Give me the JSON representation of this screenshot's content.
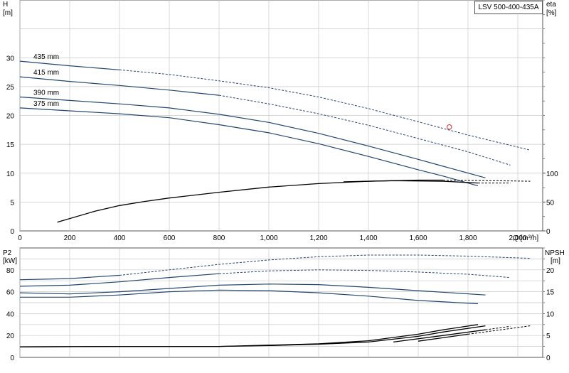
{
  "chart_data": [
    {
      "type": "line",
      "title": "LSV 500-400-435A",
      "x_unit_label": "Q [m³/h]",
      "xlim": [
        0,
        2100
      ],
      "x_ticks": [
        "0",
        "200",
        "400",
        "600",
        "800",
        "1,000",
        "1,200",
        "1,400",
        "1,600",
        "1,800",
        "2,000"
      ],
      "y_left": {
        "label": "H",
        "unit": "[m]",
        "ylim": [
          0,
          40
        ],
        "ticks": [
          "0",
          "5",
          "10",
          "15",
          "20",
          "25",
          "30"
        ]
      },
      "y_right": {
        "label": "eta",
        "unit": "[%]",
        "ylim": [
          0,
          400
        ],
        "ticks": [
          "0",
          "50",
          "100"
        ]
      },
      "grid": true,
      "head_curves": [
        {
          "name": "435 mm",
          "solid": [
            [
              0,
              29.4
            ],
            [
              200,
              28.6
            ],
            [
              400,
              27.9
            ]
          ],
          "dashed": [
            [
              400,
              27.9
            ],
            [
              600,
              27.1
            ],
            [
              800,
              26.0
            ],
            [
              1000,
              24.8
            ],
            [
              1200,
              23.2
            ],
            [
              1400,
              21.2
            ],
            [
              1600,
              18.9
            ],
            [
              1800,
              16.6
            ],
            [
              2050,
              14.0
            ]
          ]
        },
        {
          "name": "415 mm",
          "solid": [
            [
              0,
              26.7
            ],
            [
              200,
              25.9
            ],
            [
              400,
              25.2
            ],
            [
              600,
              24.4
            ],
            [
              800,
              23.5
            ]
          ],
          "dashed": [
            [
              800,
              23.5
            ],
            [
              1000,
              22.0
            ],
            [
              1200,
              20.3
            ],
            [
              1400,
              18.3
            ],
            [
              1600,
              16.0
            ],
            [
              1800,
              13.7
            ],
            [
              1970,
              11.4
            ]
          ]
        },
        {
          "name": "390 mm",
          "solid": [
            [
              0,
              23.2
            ],
            [
              200,
              22.6
            ],
            [
              400,
              22.0
            ],
            [
              600,
              21.3
            ],
            [
              800,
              20.2
            ],
            [
              1000,
              18.8
            ],
            [
              1200,
              16.9
            ],
            [
              1400,
              14.7
            ],
            [
              1600,
              12.4
            ],
            [
              1700,
              11.2
            ],
            [
              1870,
              9.2
            ]
          ],
          "dashed": []
        },
        {
          "name": "375 mm",
          "solid": [
            [
              0,
              21.3
            ],
            [
              200,
              20.8
            ],
            [
              400,
              20.3
            ],
            [
              600,
              19.6
            ],
            [
              800,
              18.4
            ],
            [
              1000,
              17.0
            ],
            [
              1200,
              15.1
            ],
            [
              1400,
              12.9
            ],
            [
              1600,
              10.6
            ],
            [
              1700,
              9.5
            ],
            [
              1840,
              7.8
            ]
          ],
          "dashed": []
        }
      ],
      "eta_curves": [
        {
          "solid": [
            [
              150,
              15
            ],
            [
              300,
              34
            ],
            [
              400,
              44
            ],
            [
              500,
              51
            ],
            [
              600,
              57
            ],
            [
              800,
              67
            ],
            [
              1000,
              76
            ],
            [
              1200,
              82
            ],
            [
              1400,
              86
            ],
            [
              1600,
              88
            ],
            [
              1700,
              88
            ]
          ],
          "dashed": [
            [
              1700,
              88
            ],
            [
              1900,
              87
            ],
            [
              2050,
              86
            ]
          ]
        },
        {
          "solid": [
            [
              1300,
              85
            ],
            [
              1500,
              87
            ],
            [
              1700,
              86
            ],
            [
              1840,
              83
            ]
          ],
          "dashed": [
            [
              1840,
              83
            ],
            [
              1970,
              83
            ]
          ]
        }
      ],
      "duty_point": {
        "x": 1725,
        "y": 18.0,
        "color": "#e0282d"
      }
    },
    {
      "type": "line",
      "xlim": [
        0,
        2100
      ],
      "y_left": {
        "label": "P2",
        "unit": "[kW]",
        "ylim": [
          0,
          100
        ],
        "ticks": [
          "0",
          "20",
          "40",
          "60",
          "80"
        ]
      },
      "y_right": {
        "label": "NPSH",
        "unit": "[m]",
        "ylim": [
          0,
          25
        ],
        "ticks": [
          "0",
          "5",
          "10",
          "15",
          "20"
        ]
      },
      "grid": true,
      "power_curves": [
        {
          "name": "435 mm",
          "solid": [
            [
              0,
              71
            ],
            [
              200,
              72
            ],
            [
              400,
              75
            ]
          ],
          "dashed": [
            [
              400,
              75
            ],
            [
              600,
              80
            ],
            [
              800,
              85
            ],
            [
              1000,
              89
            ],
            [
              1200,
              92
            ],
            [
              1400,
              93.5
            ],
            [
              1600,
              93.5
            ],
            [
              1800,
              92.5
            ],
            [
              2050,
              90.5
            ]
          ]
        },
        {
          "name": "415 mm",
          "solid": [
            [
              0,
              65
            ],
            [
              200,
              66
            ],
            [
              400,
              69
            ],
            [
              600,
              73
            ],
            [
              800,
              76.5
            ]
          ],
          "dashed": [
            [
              800,
              76.5
            ],
            [
              1000,
              79
            ],
            [
              1200,
              80
            ],
            [
              1400,
              79.5
            ],
            [
              1600,
              78
            ],
            [
              1800,
              76
            ],
            [
              1970,
              73
            ]
          ]
        },
        {
          "name": "390 mm",
          "solid": [
            [
              0,
              59
            ],
            [
              200,
              58
            ],
            [
              400,
              60
            ],
            [
              600,
              63
            ],
            [
              800,
              66
            ],
            [
              1000,
              67
            ],
            [
              1200,
              66.5
            ],
            [
              1400,
              64
            ],
            [
              1600,
              61
            ],
            [
              1870,
              57
            ]
          ],
          "dashed": []
        },
        {
          "name": "375 mm",
          "solid": [
            [
              0,
              55
            ],
            [
              200,
              55
            ],
            [
              400,
              57
            ],
            [
              600,
              60
            ],
            [
              800,
              61.5
            ],
            [
              1000,
              61
            ],
            [
              1200,
              59
            ],
            [
              1400,
              56
            ],
            [
              1600,
              52
            ],
            [
              1840,
              49
            ]
          ],
          "dashed": []
        }
      ],
      "npsh_curves": [
        {
          "solid": [
            [
              0,
              2.4
            ],
            [
              400,
              2.5
            ],
            [
              800,
              2.5
            ],
            [
              1000,
              2.8
            ],
            [
              1200,
              3.1
            ],
            [
              1400,
              3.8
            ],
            [
              1600,
              5.3
            ],
            [
              1700,
              6.3
            ],
            [
              1840,
              7.5
            ]
          ],
          "dashed": []
        },
        {
          "solid": [
            [
              0,
              2.4
            ],
            [
              400,
              2.5
            ],
            [
              800,
              2.5
            ],
            [
              1000,
              2.7
            ],
            [
              1200,
              3.0
            ],
            [
              1400,
              3.5
            ],
            [
              1600,
              4.8
            ],
            [
              1700,
              5.8
            ],
            [
              1870,
              7.2
            ]
          ],
          "dashed": []
        },
        {
          "solid": [
            [
              1500,
              3.5
            ],
            [
              1700,
              5.0
            ],
            [
              1870,
              6.3
            ]
          ],
          "dashed": [
            [
              1870,
              6.3
            ],
            [
              1970,
              7.1
            ]
          ]
        },
        {
          "solid": [
            [
              1600,
              3.7
            ],
            [
              1800,
              5.3
            ]
          ],
          "dashed": [
            [
              1800,
              5.3
            ],
            [
              2050,
              7.2
            ]
          ]
        }
      ]
    }
  ]
}
